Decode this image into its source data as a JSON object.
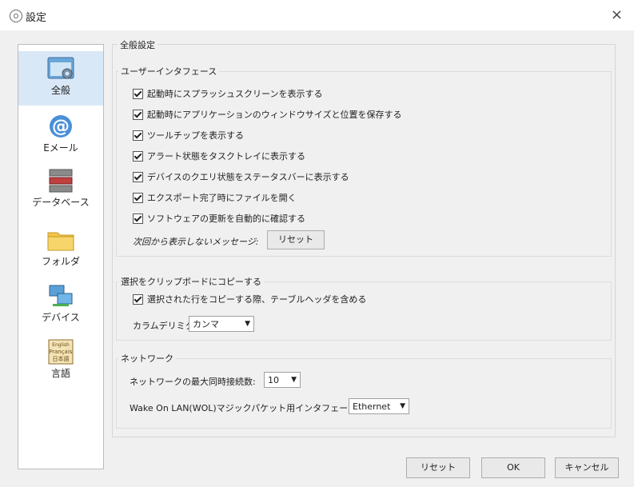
{
  "window": {
    "title": "設定",
    "close": "×"
  },
  "sidebar": {
    "items": [
      {
        "label": "全般",
        "icon": "general-settings-icon"
      },
      {
        "label": "Eメール",
        "icon": "email-icon"
      },
      {
        "label": "データベース",
        "icon": "database-icon"
      },
      {
        "label": "フォルダ",
        "icon": "folder-icon"
      },
      {
        "label": "デバイス",
        "icon": "devices-icon"
      },
      {
        "label": "言語",
        "icon": "language-icon"
      }
    ],
    "language_icon_text": [
      "English",
      "Français",
      "日本語"
    ]
  },
  "general": {
    "title": "全般設定",
    "ui": {
      "title": "ユーザーインタフェース",
      "checks": [
        "起動時にスプラッシュスクリーンを表示する",
        "起動時にアプリケーションのウィンドウサイズと位置を保存する",
        "ツールチップを表示する",
        "アラート状態をタスクトレイに表示する",
        "デバイスのクエリ状態をステータスバーに表示する",
        "エクスポート完了時にファイルを開く",
        "ソフトウェアの更新を自動的に確認する"
      ],
      "msg_label": "次回から表示しないメッセージ:",
      "reset": "リセット"
    },
    "clipboard": {
      "title": "選択をクリップボードにコピーする",
      "check": "選択された行をコピーする際、テーブルヘッダを含める",
      "delim_label": "カラムデリミタ:",
      "delim_value": "カンマ"
    },
    "network": {
      "title": "ネットワーク",
      "max_label": "ネットワークの最大同時接続数:",
      "max_value": "10",
      "wol_label": "Wake On LAN(WOL)マジックパケット用インタフェース:",
      "wol_value": "Ethernet"
    }
  },
  "footer": {
    "reset": "リセット",
    "ok": "OK",
    "cancel": "キャンセル"
  },
  "colors": {
    "selected": "#d9e8f7",
    "border": "#adadad"
  }
}
